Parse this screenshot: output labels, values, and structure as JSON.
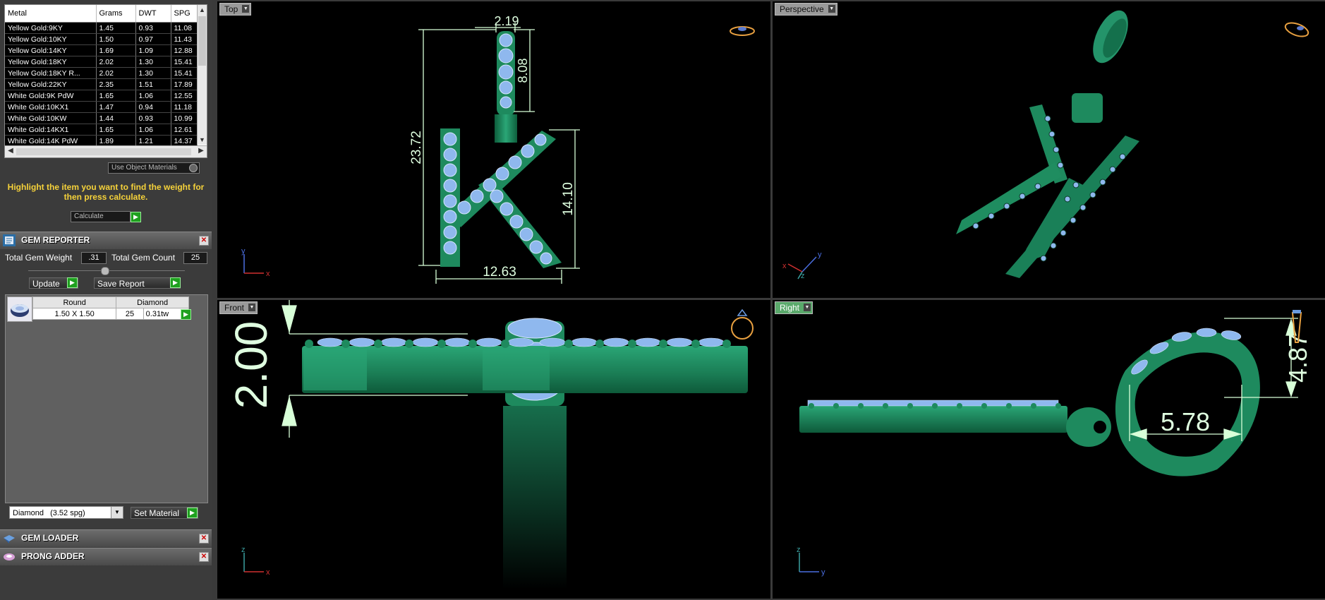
{
  "metal_table": {
    "headers": [
      "Metal",
      "Grams",
      "DWT",
      "SPG"
    ],
    "rows": [
      [
        "Yellow Gold:9KY",
        "1.45",
        "0.93",
        "11.08"
      ],
      [
        "Yellow Gold:10KY",
        "1.50",
        "0.97",
        "11.43"
      ],
      [
        "Yellow Gold:14KY",
        "1.69",
        "1.09",
        "12.88"
      ],
      [
        "Yellow Gold:18KY",
        "2.02",
        "1.30",
        "15.41"
      ],
      [
        "Yellow Gold:18KY R...",
        "2.02",
        "1.30",
        "15.41"
      ],
      [
        "Yellow Gold:22KY",
        "2.35",
        "1.51",
        "17.89"
      ],
      [
        "White Gold:9K PdW",
        "1.65",
        "1.06",
        "12.55"
      ],
      [
        "White Gold:10KX1",
        "1.47",
        "0.94",
        "11.18"
      ],
      [
        "White Gold:10KW",
        "1.44",
        "0.93",
        "10.99"
      ],
      [
        "White Gold:14KX1",
        "1.65",
        "1.06",
        "12.61"
      ],
      [
        "White Gold:14K PdW",
        "1.89",
        "1.21",
        "14.37"
      ]
    ]
  },
  "use_object_materials": "Use Object Materials",
  "hint": "Highlight the item you want to find the weight for then press calculate.",
  "calculate_label": "Calculate",
  "gem_reporter": {
    "title": "GEM REPORTER",
    "total_weight_label": "Total Gem Weight",
    "total_weight_value": ".31",
    "total_count_label": "Total Gem Count",
    "total_count_value": "25",
    "update_label": "Update",
    "save_report_label": "Save Report",
    "gem": {
      "shape": "Round",
      "material": "Diamond",
      "size": "1.50 X 1.50",
      "count": "25",
      "weight": "0.31tw"
    }
  },
  "material_select": {
    "value": "Diamond",
    "spg": "(3.52 spg)"
  },
  "set_material_label": "Set Material",
  "gem_loader_title": "GEM LOADER",
  "prong_adder_title": "PRONG ADDER",
  "viewports": {
    "top": {
      "label": "Top",
      "dims": {
        "d1": "2.19",
        "d2": "8.08",
        "d3": "23.72",
        "d4": "14.10",
        "d5": "12.63"
      }
    },
    "perspective": {
      "label": "Perspective"
    },
    "front": {
      "label": "Front",
      "dims": {
        "d1": "2.00"
      }
    },
    "right": {
      "label": "Right",
      "dims": {
        "d1": "4.87",
        "d2": "5.78"
      }
    }
  },
  "axes": {
    "x": "x",
    "y": "y",
    "z": "z"
  },
  "colors": {
    "metal": "#1e8a5e",
    "gem": "#7fb0e8",
    "dimension": "#d8ffd8",
    "hint": "#f6d23a",
    "active_label": "#5aa96b"
  }
}
